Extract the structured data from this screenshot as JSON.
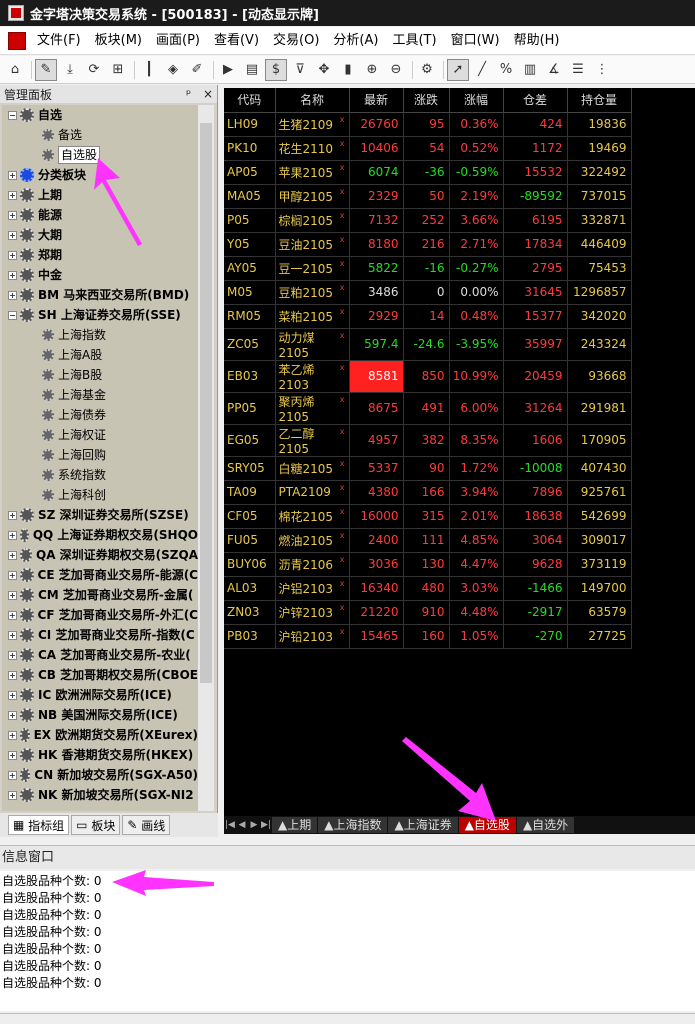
{
  "window": {
    "title": "金字塔决策交易系统 - [500183] - [动态显示牌]"
  },
  "menu": [
    "文件(F)",
    "板块(M)",
    "画面(P)",
    "查看(V)",
    "交易(O)",
    "分析(A)",
    "工具(T)",
    "窗口(W)",
    "帮助(H)"
  ],
  "left_panel": {
    "title": "管理面板",
    "head_buttons": [
      "ᵖ",
      "×"
    ],
    "tree": [
      {
        "label": "自选",
        "level": 0,
        "expander": "−",
        "bold": true
      },
      {
        "label": "备选",
        "level": 1
      },
      {
        "label": "自选股",
        "level": 1,
        "selected": true
      },
      {
        "label": "分类板块",
        "level": 0,
        "expander": "+",
        "bold": true,
        "blue": true
      },
      {
        "label": "上期",
        "level": 0,
        "expander": "+",
        "bold": true
      },
      {
        "label": "能源",
        "level": 0,
        "expander": "+",
        "bold": true
      },
      {
        "label": "大期",
        "level": 0,
        "expander": "+",
        "bold": true
      },
      {
        "label": "郑期",
        "level": 0,
        "expander": "+",
        "bold": true
      },
      {
        "label": "中金",
        "level": 0,
        "expander": "+",
        "bold": true
      },
      {
        "label": "BM 马来西亚交易所(BMD)",
        "level": 0,
        "expander": "+",
        "bold": true
      },
      {
        "label": "SH 上海证券交易所(SSE)",
        "level": 0,
        "expander": "−",
        "bold": true
      },
      {
        "label": "上海指数",
        "level": 1
      },
      {
        "label": "上海A股",
        "level": 1
      },
      {
        "label": "上海B股",
        "level": 1
      },
      {
        "label": "上海基金",
        "level": 1
      },
      {
        "label": "上海债券",
        "level": 1
      },
      {
        "label": "上海权证",
        "level": 1
      },
      {
        "label": "上海回购",
        "level": 1
      },
      {
        "label": "系统指数",
        "level": 1
      },
      {
        "label": "上海科创",
        "level": 1
      },
      {
        "label": "SZ 深圳证券交易所(SZSE)",
        "level": 0,
        "expander": "+",
        "bold": true
      },
      {
        "label": "QQ 上海证券期权交易(SHQO",
        "level": 0,
        "expander": "+",
        "bold": true
      },
      {
        "label": "QA 深圳证券期权交易(SZQA",
        "level": 0,
        "expander": "+",
        "bold": true
      },
      {
        "label": "CE 芝加哥商业交易所-能源(C",
        "level": 0,
        "expander": "+",
        "bold": true
      },
      {
        "label": "CM 芝加哥商业交易所-金属(",
        "level": 0,
        "expander": "+",
        "bold": true
      },
      {
        "label": "CF 芝加哥商业交易所-外汇(C",
        "level": 0,
        "expander": "+",
        "bold": true
      },
      {
        "label": "CI 芝加哥商业交易所-指数(C",
        "level": 0,
        "expander": "+",
        "bold": true
      },
      {
        "label": "CA 芝加哥商业交易所-农业(",
        "level": 0,
        "expander": "+",
        "bold": true
      },
      {
        "label": "CB 芝加哥期权交易所(CBOE",
        "level": 0,
        "expander": "+",
        "bold": true
      },
      {
        "label": "IC 欧洲洲际交易所(ICE)",
        "level": 0,
        "expander": "+",
        "bold": true
      },
      {
        "label": "NB 美国洲际交易所(ICE)",
        "level": 0,
        "expander": "+",
        "bold": true
      },
      {
        "label": "EX 欧洲期货交易所(XEurex)",
        "level": 0,
        "expander": "+",
        "bold": true
      },
      {
        "label": "HK 香港期货交易所(HKEX)",
        "level": 0,
        "expander": "+",
        "bold": true
      },
      {
        "label": "CN 新加坡交易所(SGX-A50)",
        "level": 0,
        "expander": "+",
        "bold": true
      },
      {
        "label": "NK 新加坡交易所(SGX-NI2",
        "level": 0,
        "expander": "+",
        "bold": true
      }
    ],
    "tabs": [
      "指标组",
      "板块",
      "画线"
    ]
  },
  "grid": {
    "headers": [
      "代码",
      "名称",
      "最新",
      "涨跌",
      "涨幅",
      "仓差",
      "持仓量"
    ],
    "rows": [
      {
        "code": "LH09",
        "name": "生猪2109",
        "last": "26760",
        "chg": "95",
        "pct": "0.36%",
        "oi_chg": "424",
        "oi": "19836",
        "dir": "up",
        "oi_dir": "up"
      },
      {
        "code": "PK10",
        "name": "花生2110",
        "last": "10406",
        "chg": "54",
        "pct": "0.52%",
        "oi_chg": "1172",
        "oi": "19469",
        "dir": "up",
        "oi_dir": "up"
      },
      {
        "code": "AP05",
        "name": "苹果2105",
        "last": "6074",
        "chg": "-36",
        "pct": "-0.59%",
        "oi_chg": "15532",
        "oi": "322492",
        "dir": "down",
        "oi_dir": "up"
      },
      {
        "code": "MA05",
        "name": "甲醇2105",
        "last": "2329",
        "chg": "50",
        "pct": "2.19%",
        "oi_chg": "-89592",
        "oi": "737015",
        "dir": "up",
        "oi_dir": "down"
      },
      {
        "code": "P05",
        "name": "棕榈2105",
        "last": "7132",
        "chg": "252",
        "pct": "3.66%",
        "oi_chg": "6195",
        "oi": "332871",
        "dir": "up",
        "oi_dir": "up"
      },
      {
        "code": "Y05",
        "name": "豆油2105",
        "last": "8180",
        "chg": "216",
        "pct": "2.71%",
        "oi_chg": "17834",
        "oi": "446409",
        "dir": "up",
        "oi_dir": "up"
      },
      {
        "code": "AY05",
        "name": "豆一2105",
        "last": "5822",
        "chg": "-16",
        "pct": "-0.27%",
        "oi_chg": "2795",
        "oi": "75453",
        "dir": "down",
        "oi_dir": "up"
      },
      {
        "code": "M05",
        "name": "豆粕2105",
        "last": "3486",
        "chg": "0",
        "pct": "0.00%",
        "oi_chg": "31645",
        "oi": "1296857",
        "dir": "flat",
        "oi_dir": "up"
      },
      {
        "code": "RM05",
        "name": "菜粕2105",
        "last": "2929",
        "chg": "14",
        "pct": "0.48%",
        "oi_chg": "15377",
        "oi": "342020",
        "dir": "up",
        "oi_dir": "up"
      },
      {
        "code": "ZC05",
        "name": "动力煤2105",
        "last": "597.4",
        "chg": "-24.6",
        "pct": "-3.95%",
        "oi_chg": "35997",
        "oi": "243324",
        "dir": "down",
        "oi_dir": "up"
      },
      {
        "code": "EB03",
        "name": "苯乙烯2103",
        "last": "8581",
        "chg": "850",
        "pct": "10.99%",
        "oi_chg": "20459",
        "oi": "93668",
        "dir": "up",
        "oi_dir": "up",
        "hl": true
      },
      {
        "code": "PP05",
        "name": "聚丙烯2105",
        "last": "8675",
        "chg": "491",
        "pct": "6.00%",
        "oi_chg": "31264",
        "oi": "291981",
        "dir": "up",
        "oi_dir": "up"
      },
      {
        "code": "EG05",
        "name": "乙二醇2105",
        "last": "4957",
        "chg": "382",
        "pct": "8.35%",
        "oi_chg": "1606",
        "oi": "170905",
        "dir": "up",
        "oi_dir": "up"
      },
      {
        "code": "SRY05",
        "name": "白糖2105",
        "last": "5337",
        "chg": "90",
        "pct": "1.72%",
        "oi_chg": "-10008",
        "oi": "407430",
        "dir": "up",
        "oi_dir": "down"
      },
      {
        "code": "TA09",
        "name": "PTA2109",
        "last": "4380",
        "chg": "166",
        "pct": "3.94%",
        "oi_chg": "7896",
        "oi": "925761",
        "dir": "up",
        "oi_dir": "up"
      },
      {
        "code": "CF05",
        "name": "棉花2105",
        "last": "16000",
        "chg": "315",
        "pct": "2.01%",
        "oi_chg": "18638",
        "oi": "542699",
        "dir": "up",
        "oi_dir": "up"
      },
      {
        "code": "FU05",
        "name": "燃油2105",
        "last": "2400",
        "chg": "111",
        "pct": "4.85%",
        "oi_chg": "3064",
        "oi": "309017",
        "dir": "up",
        "oi_dir": "up"
      },
      {
        "code": "BUY06",
        "name": "沥青2106",
        "last": "3036",
        "chg": "130",
        "pct": "4.47%",
        "oi_chg": "9628",
        "oi": "373119",
        "dir": "up",
        "oi_dir": "up"
      },
      {
        "code": "AL03",
        "name": "沪铝2103",
        "last": "16340",
        "chg": "480",
        "pct": "3.03%",
        "oi_chg": "-1466",
        "oi": "149700",
        "dir": "up",
        "oi_dir": "down"
      },
      {
        "code": "ZN03",
        "name": "沪锌2103",
        "last": "21220",
        "chg": "910",
        "pct": "4.48%",
        "oi_chg": "-2917",
        "oi": "63579",
        "dir": "up",
        "oi_dir": "down"
      },
      {
        "code": "PB03",
        "name": "沪铅2103",
        "last": "15465",
        "chg": "160",
        "pct": "1.05%",
        "oi_chg": "-270",
        "oi": "27725",
        "dir": "up",
        "oi_dir": "down"
      }
    ]
  },
  "sheet_tabs": [
    {
      "label": "▲上期",
      "active": false
    },
    {
      "label": "▲上海指数",
      "active": false
    },
    {
      "label": "▲上海证券",
      "active": false
    },
    {
      "label": "▲自选股",
      "active": true
    },
    {
      "label": "▲自选外",
      "active": false
    }
  ],
  "info": {
    "title": "信息窗口",
    "lines": [
      "自选股品种个数: 0",
      "自选股品种个数: 0",
      "自选股品种个数: 0",
      "自选股品种个数: 0",
      "自选股品种个数: 0",
      "自选股品种个数: 0",
      "自选股品种个数: 0"
    ]
  },
  "colors": {
    "annotation_arrow": "#ff33ff",
    "up": "#ff3b3b",
    "down": "#22dd22",
    "highlight": "#ff2020"
  }
}
